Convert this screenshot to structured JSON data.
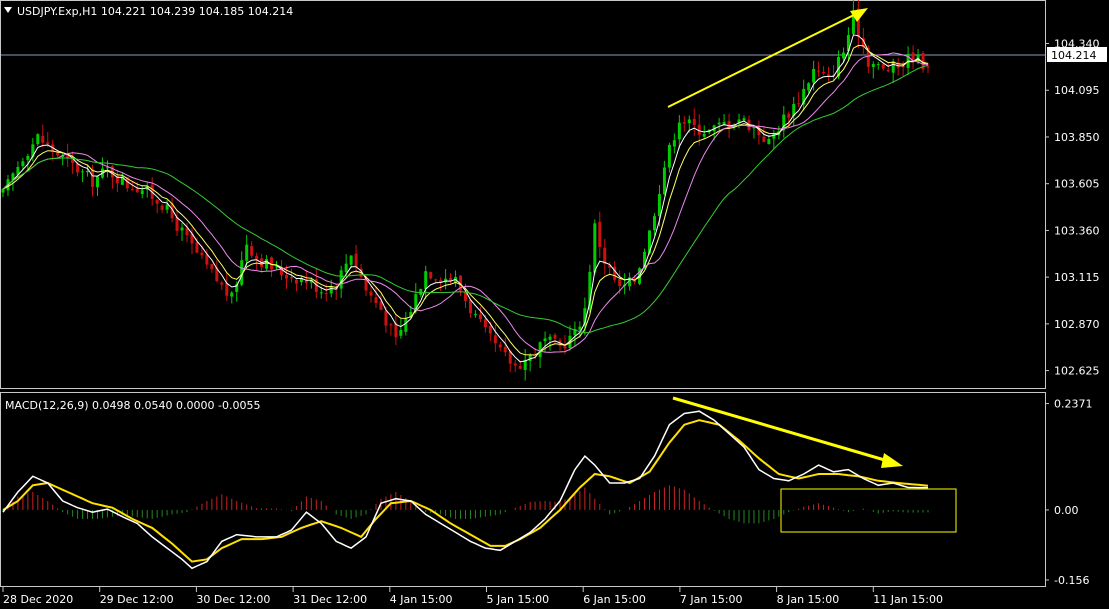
{
  "price_panel": {
    "header": "USDJPY.Exp,H1  104.221 104.239 104.185 104.214",
    "current_price_label": "104.214"
  },
  "macd_panel": {
    "header": "MACD(12,26,9) 0.0498 0.0540 0.0000 -0.0055"
  },
  "colors": {
    "background": "#000000",
    "bull_candle": "#00cc00",
    "bear_candle": "#cc1111",
    "ma_fast": "#ffffff",
    "ma_mid": "#ffff66",
    "ma_slow": "#ee88ee",
    "ma_long": "#33cc33",
    "macd_line": "#ffffff",
    "signal_line": "#ffe000",
    "histogram_positive": "#cc2222",
    "histogram_negative": "#228822",
    "annotation": "#ffff00",
    "current_price_line": "#8c9bbf"
  },
  "chart_data": [
    {
      "type": "candlestick",
      "title": "USDJPY.Exp,H1",
      "ohlc_last": {
        "open": 104.221,
        "high": 104.239,
        "low": 104.185,
        "close": 104.214
      },
      "x_tick_labels": [
        "28 Dec 2020",
        "29 Dec 12:00",
        "30 Dec 12:00",
        "31 Dec 12:00",
        "4 Jan 15:00",
        "5 Jan 15:00",
        "6 Jan 15:00",
        "7 Jan 15:00",
        "8 Jan 15:00",
        "11 Jan 15:00"
      ],
      "y_tick_labels": [
        "104.340",
        "104.095",
        "103.850",
        "103.605",
        "103.360",
        "103.115",
        "102.870",
        "102.625"
      ],
      "ylim": [
        102.56,
        104.5
      ],
      "current_price": 104.214,
      "close_path": [
        [
          0,
          103.55
        ],
        [
          4,
          103.75
        ],
        [
          7,
          103.85
        ],
        [
          10,
          103.78
        ],
        [
          14,
          103.7
        ],
        [
          18,
          103.62
        ],
        [
          21,
          103.68
        ],
        [
          25,
          103.6
        ],
        [
          28,
          103.58
        ],
        [
          32,
          103.5
        ],
        [
          36,
          103.35
        ],
        [
          40,
          103.2
        ],
        [
          43,
          103.1
        ],
        [
          46,
          103.0
        ],
        [
          49,
          103.3
        ],
        [
          51,
          103.22
        ],
        [
          55,
          103.15
        ],
        [
          58,
          103.12
        ],
        [
          61,
          103.1
        ],
        [
          64,
          103.05
        ],
        [
          67,
          103.08
        ],
        [
          70,
          103.25
        ],
        [
          73,
          103.05
        ],
        [
          76,
          102.95
        ],
        [
          79,
          102.78
        ],
        [
          82,
          102.95
        ],
        [
          85,
          103.15
        ],
        [
          88,
          103.12
        ],
        [
          91,
          103.1
        ],
        [
          94,
          102.95
        ],
        [
          97,
          102.82
        ],
        [
          100,
          102.72
        ],
        [
          103,
          102.65
        ],
        [
          106,
          102.7
        ],
        [
          109,
          102.78
        ],
        [
          112,
          102.75
        ],
        [
          115,
          102.82
        ],
        [
          117,
          102.95
        ],
        [
          119,
          103.38
        ],
        [
          121,
          103.2
        ],
        [
          124,
          103.05
        ],
        [
          127,
          103.1
        ],
        [
          130,
          103.35
        ],
        [
          133,
          103.7
        ],
        [
          136,
          103.95
        ],
        [
          139,
          103.9
        ],
        [
          142,
          103.88
        ],
        [
          145,
          103.92
        ],
        [
          148,
          103.95
        ],
        [
          151,
          103.9
        ],
        [
          154,
          103.82
        ],
        [
          157,
          103.95
        ],
        [
          160,
          104.05
        ],
        [
          163,
          104.2
        ],
        [
          166,
          104.15
        ],
        [
          169,
          104.3
        ],
        [
          171,
          104.48
        ],
        [
          174,
          104.25
        ],
        [
          177,
          104.2
        ],
        [
          180,
          104.22
        ],
        [
          183,
          104.28
        ],
        [
          186,
          104.214
        ]
      ],
      "annotation": "rising yellow arrow from the 7 Jan high to the 11 Jan high"
    },
    {
      "type": "macd",
      "title": "MACD(12,26,9)",
      "values": {
        "macd": 0.0498,
        "signal": 0.054,
        "main": 0.0,
        "histogram": -0.0055
      },
      "y_tick_labels": [
        "0.2371",
        "0.00",
        "-0.156"
      ],
      "ylim": [
        -0.165,
        0.245
      ],
      "macd_path": [
        [
          0,
          -0.005
        ],
        [
          3,
          0.04
        ],
        [
          6,
          0.075
        ],
        [
          9,
          0.06
        ],
        [
          12,
          0.02
        ],
        [
          15,
          0.005
        ],
        [
          18,
          -0.005
        ],
        [
          21,
          0.002
        ],
        [
          24,
          -0.015
        ],
        [
          27,
          -0.03
        ],
        [
          30,
          -0.06
        ],
        [
          33,
          -0.085
        ],
        [
          36,
          -0.11
        ],
        [
          38,
          -0.13
        ],
        [
          41,
          -0.115
        ],
        [
          44,
          -0.07
        ],
        [
          47,
          -0.055
        ],
        [
          51,
          -0.06
        ],
        [
          55,
          -0.06
        ],
        [
          58,
          -0.045
        ],
        [
          61,
          -0.005
        ],
        [
          64,
          -0.03
        ],
        [
          67,
          -0.07
        ],
        [
          70,
          -0.085
        ],
        [
          73,
          -0.06
        ],
        [
          76,
          0.015
        ],
        [
          79,
          0.025
        ],
        [
          82,
          0.02
        ],
        [
          85,
          -0.01
        ],
        [
          88,
          -0.03
        ],
        [
          91,
          -0.05
        ],
        [
          94,
          -0.07
        ],
        [
          97,
          -0.085
        ],
        [
          100,
          -0.09
        ],
        [
          103,
          -0.07
        ],
        [
          106,
          -0.05
        ],
        [
          109,
          -0.02
        ],
        [
          112,
          0.02
        ],
        [
          115,
          0.09
        ],
        [
          117,
          0.12
        ],
        [
          119,
          0.1
        ],
        [
          122,
          0.06
        ],
        [
          125,
          0.06
        ],
        [
          128,
          0.07
        ],
        [
          131,
          0.12
        ],
        [
          134,
          0.19
        ],
        [
          137,
          0.215
        ],
        [
          140,
          0.22
        ],
        [
          143,
          0.2
        ],
        [
          146,
          0.17
        ],
        [
          149,
          0.14
        ],
        [
          152,
          0.09
        ],
        [
          155,
          0.07
        ],
        [
          158,
          0.065
        ],
        [
          161,
          0.08
        ],
        [
          164,
          0.1
        ],
        [
          167,
          0.085
        ],
        [
          170,
          0.09
        ],
        [
          173,
          0.07
        ],
        [
          176,
          0.055
        ],
        [
          179,
          0.06
        ],
        [
          182,
          0.05
        ],
        [
          186,
          0.0498
        ]
      ],
      "signal_path": [
        [
          0,
          0.0
        ],
        [
          3,
          0.02
        ],
        [
          6,
          0.055
        ],
        [
          9,
          0.06
        ],
        [
          12,
          0.045
        ],
        [
          15,
          0.03
        ],
        [
          18,
          0.015
        ],
        [
          22,
          0.005
        ],
        [
          26,
          -0.02
        ],
        [
          30,
          -0.04
        ],
        [
          34,
          -0.075
        ],
        [
          38,
          -0.115
        ],
        [
          41,
          -0.11
        ],
        [
          44,
          -0.085
        ],
        [
          48,
          -0.065
        ],
        [
          52,
          -0.065
        ],
        [
          56,
          -0.06
        ],
        [
          60,
          -0.04
        ],
        [
          64,
          -0.025
        ],
        [
          68,
          -0.04
        ],
        [
          72,
          -0.06
        ],
        [
          75,
          -0.02
        ],
        [
          78,
          0.015
        ],
        [
          82,
          0.02
        ],
        [
          86,
          0.0
        ],
        [
          90,
          -0.03
        ],
        [
          94,
          -0.055
        ],
        [
          98,
          -0.08
        ],
        [
          101,
          -0.08
        ],
        [
          104,
          -0.065
        ],
        [
          108,
          -0.04
        ],
        [
          112,
          0.0
        ],
        [
          116,
          0.05
        ],
        [
          119,
          0.08
        ],
        [
          122,
          0.075
        ],
        [
          126,
          0.06
        ],
        [
          130,
          0.085
        ],
        [
          134,
          0.15
        ],
        [
          137,
          0.19
        ],
        [
          140,
          0.2
        ],
        [
          144,
          0.19
        ],
        [
          148,
          0.155
        ],
        [
          152,
          0.115
        ],
        [
          156,
          0.08
        ],
        [
          160,
          0.07
        ],
        [
          164,
          0.08
        ],
        [
          168,
          0.08
        ],
        [
          172,
          0.075
        ],
        [
          176,
          0.065
        ],
        [
          180,
          0.06
        ],
        [
          186,
          0.054
        ]
      ],
      "hist_path": [
        [
          0,
          -0.004
        ],
        [
          3,
          0.03
        ],
        [
          6,
          0.04
        ],
        [
          9,
          0.02
        ],
        [
          12,
          -0.005
        ],
        [
          15,
          -0.02
        ],
        [
          19,
          -0.02
        ],
        [
          24,
          -0.012
        ],
        [
          30,
          -0.02
        ],
        [
          34,
          -0.01
        ],
        [
          37,
          -0.005
        ],
        [
          41,
          0.02
        ],
        [
          44,
          0.035
        ],
        [
          47,
          0.02
        ],
        [
          51,
          0.004
        ],
        [
          55,
          0.003
        ],
        [
          58,
          -0.002
        ],
        [
          61,
          0.03
        ],
        [
          64,
          0.02
        ],
        [
          67,
          -0.01
        ],
        [
          70,
          -0.02
        ],
        [
          73,
          -0.01
        ],
        [
          76,
          0.025
        ],
        [
          79,
          0.04
        ],
        [
          82,
          0.02
        ],
        [
          85,
          -0.005
        ],
        [
          88,
          -0.01
        ],
        [
          91,
          -0.02
        ],
        [
          94,
          -0.02
        ],
        [
          97,
          -0.015
        ],
        [
          100,
          -0.01
        ],
        [
          103,
          0.005
        ],
        [
          106,
          0.018
        ],
        [
          109,
          0.02
        ],
        [
          112,
          0.018
        ],
        [
          115,
          0.035
        ],
        [
          117,
          0.05
        ],
        [
          119,
          0.025
        ],
        [
          122,
          -0.01
        ],
        [
          125,
          0.0
        ],
        [
          128,
          0.02
        ],
        [
          131,
          0.04
        ],
        [
          134,
          0.055
        ],
        [
          137,
          0.045
        ],
        [
          140,
          0.02
        ],
        [
          143,
          -0.002
        ],
        [
          146,
          -0.02
        ],
        [
          149,
          -0.03
        ],
        [
          152,
          -0.03
        ],
        [
          155,
          -0.02
        ],
        [
          158,
          -0.005
        ],
        [
          161,
          0.007
        ],
        [
          164,
          0.015
        ],
        [
          167,
          0.005
        ],
        [
          170,
          -0.005
        ],
        [
          173,
          0.003
        ],
        [
          176,
          -0.008
        ],
        [
          179,
          -0.003
        ],
        [
          182,
          -0.006
        ],
        [
          186,
          -0.0055
        ]
      ],
      "annotation": "falling yellow arrow along the MACD peaks; divergence box around the 8-11 Jan histogram"
    }
  ]
}
